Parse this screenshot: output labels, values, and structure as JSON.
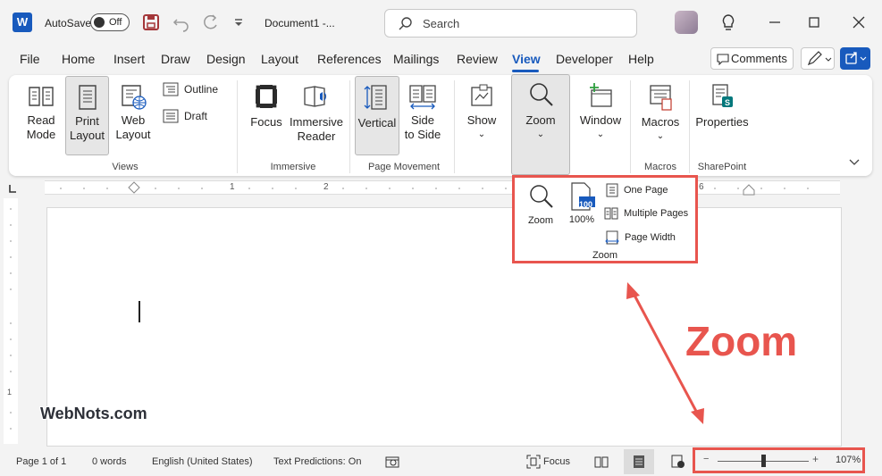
{
  "titlebar": {
    "app_icon": "W",
    "autosave_label": "AutoSave",
    "autosave_state": "Off",
    "document_title": "Document1  -...",
    "search_placeholder": "Search"
  },
  "menu": {
    "tabs": [
      {
        "label": "File"
      },
      {
        "label": "Home"
      },
      {
        "label": "Insert"
      },
      {
        "label": "Draw"
      },
      {
        "label": "Design"
      },
      {
        "label": "Layout"
      },
      {
        "label": "References"
      },
      {
        "label": "Mailings"
      },
      {
        "label": "Review"
      },
      {
        "label": "View",
        "active": true
      },
      {
        "label": "Developer"
      },
      {
        "label": "Help"
      }
    ],
    "comments_label": "Comments"
  },
  "ribbon": {
    "views": {
      "read_mode": "Read Mode",
      "read_mode_l1": "Read",
      "read_mode_l2": "Mode",
      "print_layout_l1": "Print",
      "print_layout_l2": "Layout",
      "web_layout_l1": "Web",
      "web_layout_l2": "Layout",
      "outline": "Outline",
      "draft": "Draft",
      "group_label": "Views"
    },
    "immersive": {
      "focus": "Focus",
      "immersive_reader_l1": "Immersive",
      "immersive_reader_l2": "Reader",
      "group_label": "Immersive"
    },
    "page_movement": {
      "vertical": "Vertical",
      "side_l1": "Side",
      "side_l2": "to Side",
      "group_label": "Page Movement"
    },
    "show": {
      "label": "Show"
    },
    "zoom": {
      "label": "Zoom"
    },
    "window": {
      "label": "Window"
    },
    "macros": {
      "label": "Macros",
      "group_label": "Macros"
    },
    "sharepoint": {
      "label": "Properties",
      "group_label": "SharePoint"
    }
  },
  "zoom_popup": {
    "zoom_label": "Zoom",
    "hundred_badge": "100",
    "hundred_label": "100%",
    "one_page": "One Page",
    "multiple_pages": "Multiple Pages",
    "page_width": "Page Width",
    "group_label": "Zoom"
  },
  "ruler": {
    "numbers": [
      "1",
      "2",
      "6"
    ]
  },
  "vruler": {
    "numbers": [
      "1"
    ]
  },
  "statusbar": {
    "page": "Page 1 of 1",
    "words": "0 words",
    "language": "English (United States)",
    "predictions": "Text Predictions: On",
    "focus": "Focus",
    "zoom_minus": "−",
    "zoom_plus": "+",
    "zoom_percent": "107%"
  },
  "annotation": {
    "zoom_callout": "Zoom",
    "watermark": "WebNots.com"
  },
  "colors": {
    "accent": "#185abd",
    "highlight": "#e8554e"
  }
}
